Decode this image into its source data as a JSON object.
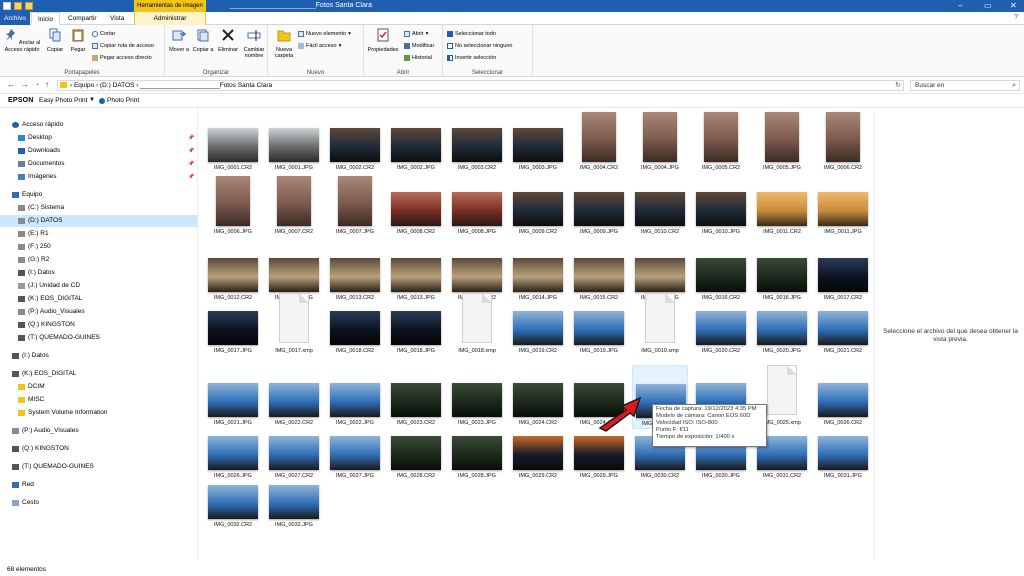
{
  "titlebar": {
    "context_label": "Herramientas de imagen",
    "title": "______________________Fotos Santa Clara",
    "minimize": "–",
    "maximize": "▭",
    "close": "✕"
  },
  "tabs": {
    "file": "Archivo",
    "home": "Inicio",
    "share": "Compartir",
    "view": "Vista",
    "manage": "Administrar",
    "help_icon": "?"
  },
  "ribbon": {
    "clipboard": {
      "label": "Portapapeles",
      "pin": "Anclar al Acceso rápido",
      "copy": "Copiar",
      "paste": "Pegar",
      "cut": "Cortar",
      "copy_path": "Copiar ruta de acceso",
      "paste_shortcut": "Pegar acceso directo"
    },
    "organize": {
      "label": "Organizar",
      "move": "Mover a",
      "copy_to": "Copiar a",
      "delete": "Eliminar",
      "rename": "Cambiar nombre"
    },
    "new": {
      "label": "Nuevo",
      "new_folder": "Nueva carpeta",
      "new_item": "Nuevo elemento",
      "easy_access": "Fácil acceso"
    },
    "open": {
      "label": "Abrir",
      "properties": "Propiedades",
      "open": "Abrir",
      "modify": "Modificar",
      "history": "Historial"
    },
    "select": {
      "label": "Seleccionar",
      "select_all": "Seleccionar todo",
      "select_none": "No seleccionar ninguno",
      "invert": "Invertir selección"
    }
  },
  "address": {
    "back": "←",
    "forward": "→",
    "dropdown": "⌄",
    "up": "↑",
    "path": "›  Equipo  ›  (D:) DATOS  ›  ______________________Fotos Santa Clara",
    "refresh": "↻",
    "search_placeholder": "Buscar en"
  },
  "epson": {
    "logo": "EPSON",
    "easy_photo_print": "Easy Photo Print",
    "dropdown": "▼",
    "photo_print": "Photo Print"
  },
  "nav": [
    {
      "label": "Acceso rápido",
      "indent": 0,
      "icon": "star",
      "pin": false
    },
    {
      "label": "Desktop",
      "indent": 1,
      "icon": "desktop",
      "pin": true
    },
    {
      "label": "Downloads",
      "indent": 1,
      "icon": "download",
      "pin": true
    },
    {
      "label": "Documentos",
      "indent": 1,
      "icon": "doc",
      "pin": true
    },
    {
      "label": "Imágenes",
      "indent": 1,
      "icon": "image",
      "pin": true
    },
    {
      "label": "Equipo",
      "indent": 0,
      "icon": "pc",
      "pin": false
    },
    {
      "label": "(C:) Sistema",
      "indent": 1,
      "icon": "drive",
      "pin": false
    },
    {
      "label": "(D:) DATOS",
      "indent": 1,
      "icon": "drive",
      "pin": false,
      "selected": true
    },
    {
      "label": "(E:) R1",
      "indent": 1,
      "icon": "drive",
      "pin": false
    },
    {
      "label": "(F:) 250",
      "indent": 1,
      "icon": "drive",
      "pin": false
    },
    {
      "label": "(G:) R2",
      "indent": 1,
      "icon": "drive",
      "pin": false
    },
    {
      "label": "(I:) Datos",
      "indent": 1,
      "icon": "usb",
      "pin": false
    },
    {
      "label": "(J:) Unidad de CD",
      "indent": 1,
      "icon": "cd",
      "pin": false
    },
    {
      "label": "(K:) EOS_DIGITAL",
      "indent": 1,
      "icon": "usb",
      "pin": false
    },
    {
      "label": "(P:) Audio_Visuales",
      "indent": 1,
      "icon": "drive",
      "pin": false
    },
    {
      "label": "(Q:) KINGSTON",
      "indent": 1,
      "icon": "usb",
      "pin": false
    },
    {
      "label": "(T:) QUEMADO-GUINES",
      "indent": 1,
      "icon": "usb",
      "pin": false
    },
    {
      "label": "(I:) Datos",
      "indent": 0,
      "icon": "usb",
      "pin": false
    },
    {
      "label": "(K:) EOS_DIGITAL",
      "indent": 0,
      "icon": "usb",
      "pin": false
    },
    {
      "label": "DCIM",
      "indent": 1,
      "icon": "folder",
      "pin": false
    },
    {
      "label": "MISC",
      "indent": 1,
      "icon": "folder",
      "pin": false
    },
    {
      "label": "System Volume Information",
      "indent": 1,
      "icon": "folder",
      "pin": false
    },
    {
      "label": "(P:) Audio_Visuales",
      "indent": 0,
      "icon": "drive",
      "pin": false
    },
    {
      "label": "(Q:) KINGSTON",
      "indent": 0,
      "icon": "usb",
      "pin": false
    },
    {
      "label": "(T:) QUEMADO-GUINES",
      "indent": 0,
      "icon": "usb",
      "pin": false
    },
    {
      "label": "Red",
      "indent": 0,
      "icon": "network",
      "pin": false
    },
    {
      "label": "Cesto",
      "indent": 0,
      "icon": "recycle",
      "pin": false
    }
  ],
  "pin_glyph": "📌",
  "files": [
    {
      "name": "IMG_0001.CR2",
      "kind": "photo",
      "scene": "room"
    },
    {
      "name": "IMG_0001.JPG",
      "kind": "photo",
      "scene": "room"
    },
    {
      "name": "IMG_0002.CR2",
      "kind": "photo",
      "scene": "street"
    },
    {
      "name": "IMG_0002.JPG",
      "kind": "photo",
      "scene": "street"
    },
    {
      "name": "IMG_0003.CR2",
      "kind": "photo",
      "scene": "street"
    },
    {
      "name": "IMG_0003.JPG",
      "kind": "photo",
      "scene": "street"
    },
    {
      "name": "IMG_0004.CR2",
      "kind": "photo",
      "scene": "tall"
    },
    {
      "name": "IMG_0004.JPG",
      "kind": "photo",
      "scene": "tall"
    },
    {
      "name": "IMG_0005.CR2",
      "kind": "photo",
      "scene": "tall"
    },
    {
      "name": "IMG_0005.JPG",
      "kind": "photo",
      "scene": "tall"
    },
    {
      "name": "IMG_0006.CR2",
      "kind": "photo",
      "scene": "tall"
    },
    {
      "name": "IMG_0006.JPG",
      "kind": "photo",
      "scene": "tall"
    },
    {
      "name": "IMG_0007.CR2",
      "kind": "photo",
      "scene": "tall"
    },
    {
      "name": "IMG_0007.JPG",
      "kind": "photo",
      "scene": "tall"
    },
    {
      "name": "IMG_0008.CR2",
      "kind": "photo",
      "scene": "redbuilding"
    },
    {
      "name": "IMG_0008.JPG",
      "kind": "photo",
      "scene": "redbuilding"
    },
    {
      "name": "IMG_0009.CR2",
      "kind": "photo",
      "scene": "street"
    },
    {
      "name": "IMG_0009.JPG",
      "kind": "photo",
      "scene": "street"
    },
    {
      "name": "IMG_0010.CR2",
      "kind": "photo",
      "scene": "street"
    },
    {
      "name": "IMG_0010.JPG",
      "kind": "photo",
      "scene": "street"
    },
    {
      "name": "IMG_0011.CR2",
      "kind": "photo",
      "scene": "sign"
    },
    {
      "name": "IMG_0011.JPG",
      "kind": "photo",
      "scene": "sign"
    },
    {
      "name": "IMG_0012.CR2",
      "kind": "photo",
      "scene": "colonial"
    },
    {
      "name": "IMG_0012.JPG",
      "kind": "photo",
      "scene": "colonial"
    },
    {
      "name": "IMG_0013.CR2",
      "kind": "photo",
      "scene": "colonial"
    },
    {
      "name": "IMG_0013.JPG",
      "kind": "photo",
      "scene": "colonial"
    },
    {
      "name": "IMG_0014.CR2",
      "kind": "photo",
      "scene": "colonial"
    },
    {
      "name": "IMG_0014.JPG",
      "kind": "photo",
      "scene": "colonial"
    },
    {
      "name": "IMG_0015.CR2",
      "kind": "photo",
      "scene": "colonial"
    },
    {
      "name": "IMG_0015.JPG",
      "kind": "photo",
      "scene": "colonial"
    },
    {
      "name": "IMG_0016.CR2",
      "kind": "photo",
      "scene": "trees"
    },
    {
      "name": "IMG_0016.JPG",
      "kind": "photo",
      "scene": "trees"
    },
    {
      "name": "IMG_0017.CR2",
      "kind": "photo",
      "scene": "night"
    },
    {
      "name": "IMG_0017.JPG",
      "kind": "photo",
      "scene": "night"
    },
    {
      "name": "IMG_0017.xmp",
      "kind": "doc"
    },
    {
      "name": "IMG_0018.CR2",
      "kind": "photo",
      "scene": "night"
    },
    {
      "name": "IMG_0018.JPG",
      "kind": "photo",
      "scene": "night"
    },
    {
      "name": "IMG_0018.xmp",
      "kind": "doc"
    },
    {
      "name": "IMG_0019.CR2",
      "kind": "photo",
      "scene": "sky"
    },
    {
      "name": "IMG_0019.JPG",
      "kind": "photo",
      "scene": "sky"
    },
    {
      "name": "IMG_0019.xmp",
      "kind": "doc"
    },
    {
      "name": "IMG_0020.CR2",
      "kind": "photo",
      "scene": "sky"
    },
    {
      "name": "IMG_0020.JPG",
      "kind": "photo",
      "scene": "sky"
    },
    {
      "name": "IMG_0021.CR2",
      "kind": "photo",
      "scene": "sky"
    },
    {
      "name": "IMG_0021.JPG",
      "kind": "photo",
      "scene": "sky"
    },
    {
      "name": "IMG_0022.CR2",
      "kind": "photo",
      "scene": "sky"
    },
    {
      "name": "IMG_0022.JPG",
      "kind": "photo",
      "scene": "sky"
    },
    {
      "name": "IMG_0023.CR2",
      "kind": "photo",
      "scene": "trees"
    },
    {
      "name": "IMG_0023.JPG",
      "kind": "photo",
      "scene": "trees"
    },
    {
      "name": "IMG_0024.CR2",
      "kind": "photo",
      "scene": "trees"
    },
    {
      "name": "IMG_0024.JPG",
      "kind": "photo",
      "scene": "trees"
    },
    {
      "name": "IMG_0025.CR2",
      "kind": "photo",
      "scene": "sky",
      "highlight": true
    },
    {
      "name": "IMG_0025.JPG",
      "kind": "photo",
      "scene": "sky"
    },
    {
      "name": "IMG_0025.xmp",
      "kind": "doc"
    },
    {
      "name": "IMG_0026.CR2",
      "kind": "photo",
      "scene": "sky"
    },
    {
      "name": "IMG_0026.JPG",
      "kind": "photo",
      "scene": "sky"
    },
    {
      "name": "IMG_0027.CR2",
      "kind": "photo",
      "scene": "sky"
    },
    {
      "name": "IMG_0027.JPG",
      "kind": "photo",
      "scene": "sky"
    },
    {
      "name": "IMG_0028.CR2",
      "kind": "photo",
      "scene": "trees"
    },
    {
      "name": "IMG_0028.JPG",
      "kind": "photo",
      "scene": "trees"
    },
    {
      "name": "IMG_0029.CR2",
      "kind": "photo",
      "scene": "sunset"
    },
    {
      "name": "IMG_0029.JPG",
      "kind": "photo",
      "scene": "sunset"
    },
    {
      "name": "IMG_0030.CR2",
      "kind": "photo",
      "scene": "sky"
    },
    {
      "name": "IMG_0030.JPG",
      "kind": "photo",
      "scene": "sky"
    },
    {
      "name": "IMG_0031.CR2",
      "kind": "photo",
      "scene": "sky"
    },
    {
      "name": "IMG_0031.JPG",
      "kind": "photo",
      "scene": "sky"
    },
    {
      "name": "IMG_0032.CR2",
      "kind": "photo",
      "scene": "sky"
    },
    {
      "name": "IMG_0032.JPG",
      "kind": "photo",
      "scene": "sky"
    }
  ],
  "tooltip": {
    "line1": "Fecha de captura: 19/12/2023 4:35 PM",
    "line2": "Modelo de cámara: Canon EOS 60D",
    "line3": "Velocidad ISO: ISO-800",
    "line4": "Punto F: f/11",
    "line5": "Tiempo de exposición: 1/400 s"
  },
  "preview": {
    "message": "Seleccione el archivo del que desea obtener la vista previa."
  },
  "status": {
    "count": "68 elementos"
  },
  "colors": {
    "titlebar": "#1f5fb0",
    "context_tab": "#f0c419",
    "selection": "#cce8ff",
    "arrow": "#e0191e"
  }
}
